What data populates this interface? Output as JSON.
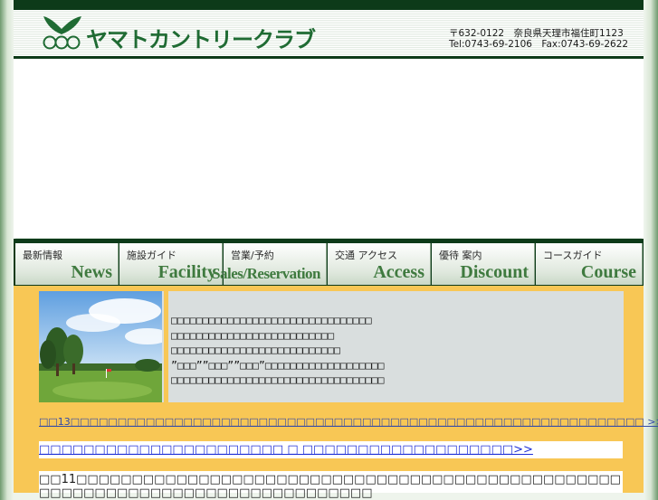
{
  "header": {
    "logo_text": "ヤマトカントリークラブ",
    "address": "〒632-0122　奈良県天理市福住町1123",
    "phone_fax": "Tel:0743-69-2106　Fax:0743-69-2622"
  },
  "nav": {
    "items": [
      {
        "jp": "最新情報",
        "en": "News"
      },
      {
        "jp": "施設ガイド",
        "en": "Facility"
      },
      {
        "jp": "営業/予約",
        "en": "Sales/Reservation"
      },
      {
        "jp": "交通 アクセス",
        "en": "Access"
      },
      {
        "jp": "優待 案内",
        "en": "Discount"
      },
      {
        "jp": "コースガイド",
        "en": "Course"
      }
    ]
  },
  "intro": {
    "lines": [
      "□□□□□□□□□□□□□□□□□□□□□□□□□□□□□□□□",
      "□□□□□□□□□□□□□□□□□□□□□□□□□□",
      "□□□□□□□□□□□□□□□□□□□□□□□□□□□",
      "”□□□””□□□””□□□”□□□□□□□□□□□□□□□□□□□",
      "□□□□□□□□□□□□□□□□□□□□□□□□□□□□□□□□□□"
    ]
  },
  "news": {
    "item1": "□□13□□□□□□□□□□□□□□□□□□□□□□□□□□□□□□□□□□□□□□□□□□□□□□□□□□□□□□□□□□□□□ >>",
    "item2": "□□□□□□□□□□□□□□□□□□□□□□ □ □□□□□□□□□□□□□□□□□□□>>",
    "item3": "□□11□□□□□□□□□□□□□□□□□□□□□□□□□□□□□□□□□□□□□□□□□□□□□□□□□□□□□□□□□□□□□□□□□□□□□□□□□□□□□□□"
  },
  "colors": {
    "dark_green": "#0d3a19",
    "content_bg": "#f8c755",
    "link_blue": "#1f2fd6"
  }
}
